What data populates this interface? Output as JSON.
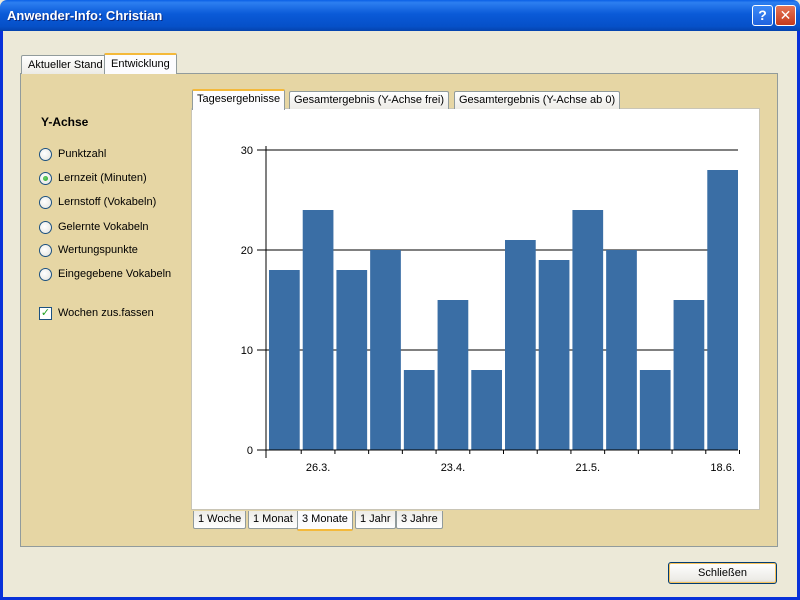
{
  "window": {
    "title": "Anwender-Info: Christian",
    "help_glyph": "?",
    "close_glyph": "✕"
  },
  "outer_tabs": [
    {
      "label": "Aktueller Stand",
      "active": false
    },
    {
      "label": "Entwicklung",
      "active": true
    }
  ],
  "yaxis_panel": {
    "title": "Y-Achse",
    "options": [
      {
        "label": "Punktzahl",
        "checked": false
      },
      {
        "label": "Lernzeit (Minuten)",
        "checked": true
      },
      {
        "label": "Lernstoff (Vokabeln)",
        "checked": false
      },
      {
        "label": "Gelernte Vokabeln",
        "checked": false
      },
      {
        "label": "Wertungspunkte",
        "checked": false
      },
      {
        "label": "Eingegebene Vokabeln",
        "checked": false
      }
    ],
    "merge_weeks": {
      "label": "Wochen zus.fassen",
      "checked": true,
      "glyph": "✓"
    }
  },
  "chart_tabs": [
    {
      "label": "Tagesergebnisse",
      "active": true
    },
    {
      "label": "Gesamtergebnis (Y-Achse frei)",
      "active": false
    },
    {
      "label": "Gesamtergebnis (Y-Achse ab 0)",
      "active": false
    }
  ],
  "range_tabs": [
    {
      "label": "1 Woche",
      "active": false
    },
    {
      "label": "1 Monat",
      "active": false
    },
    {
      "label": "3 Monate",
      "active": true
    },
    {
      "label": "1 Jahr",
      "active": false
    },
    {
      "label": "3 Jahre",
      "active": false
    }
  ],
  "close_button": {
    "label": "Schließen"
  },
  "colors": {
    "bar": "#3a6ea5",
    "accent": "#f4b93a",
    "panel": "#e6d6a4"
  },
  "chart_data": {
    "type": "bar",
    "values": [
      18,
      24,
      18,
      20,
      8,
      15,
      8,
      21,
      19,
      24,
      20,
      8,
      15,
      28
    ],
    "ylim": [
      0,
      30
    ],
    "yticks": [
      0,
      10,
      20,
      30
    ],
    "xtick_labels": [
      {
        "label": "26.3.",
        "index": 1
      },
      {
        "label": "23.4.",
        "index": 5
      },
      {
        "label": "21.5.",
        "index": 9
      },
      {
        "label": "18.6.",
        "index": 13
      }
    ],
    "grid": true
  }
}
